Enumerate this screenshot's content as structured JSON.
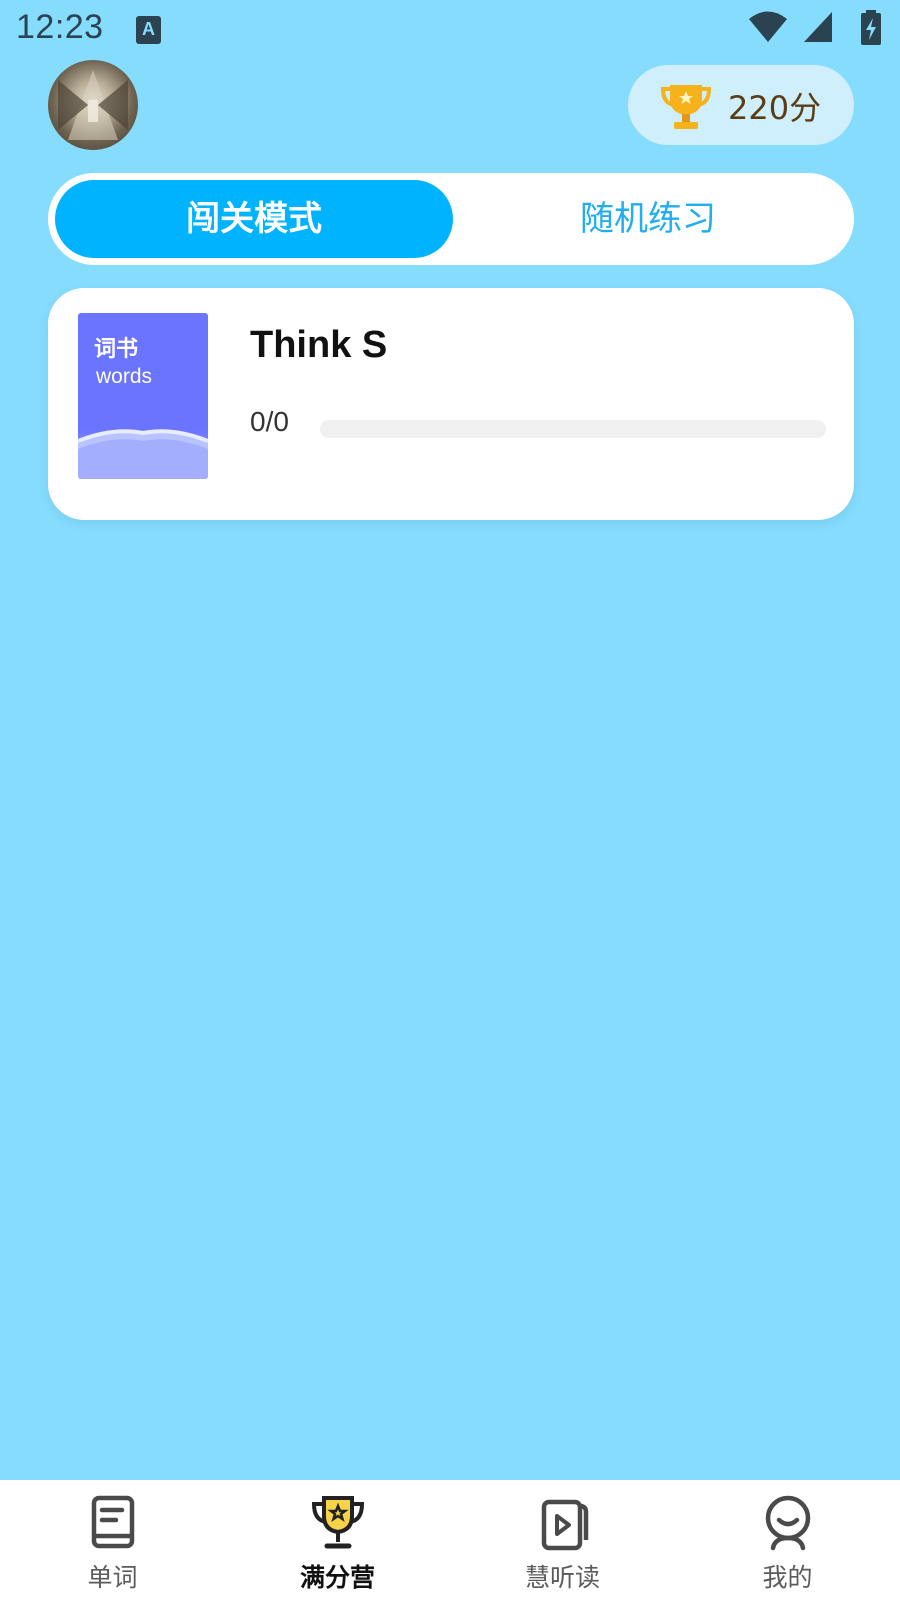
{
  "status_bar": {
    "time": "12:23",
    "notification_icon": "A"
  },
  "header": {
    "score": "220分"
  },
  "mode_tabs": {
    "active": "闯关模式",
    "inactive": "随机练习"
  },
  "book": {
    "cover_cn": "词书",
    "cover_en": "words",
    "title": "Think S",
    "progress_text": "0/0",
    "progress_fraction": 0
  },
  "nav": {
    "items": [
      {
        "label": "单词",
        "icon": "book-icon"
      },
      {
        "label": "满分营",
        "icon": "trophy-icon"
      },
      {
        "label": "慧听读",
        "icon": "video-book-icon"
      },
      {
        "label": "我的",
        "icon": "profile-icon"
      }
    ],
    "active_index": 1
  },
  "colors": {
    "background": "#86dcfd",
    "accent": "#00b3ff",
    "cover": "#6a74ff"
  }
}
